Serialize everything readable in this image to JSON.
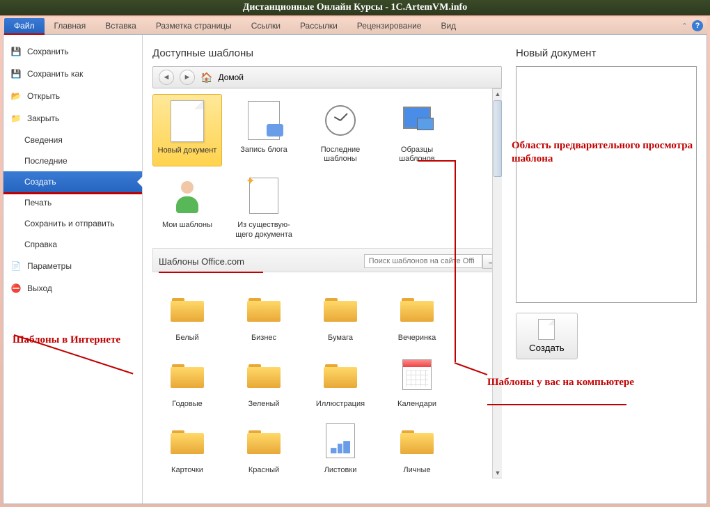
{
  "titlebar": "Дистанционные Онлайн Курсы - 1C.ArtemVM.info",
  "ribbon": {
    "file": "Файл",
    "tabs": [
      "Главная",
      "Вставка",
      "Разметка страницы",
      "Ссылки",
      "Рассылки",
      "Рецензирование",
      "Вид"
    ]
  },
  "nav": {
    "save": "Сохранить",
    "save_as": "Сохранить как",
    "open": "Открыть",
    "close": "Закрыть",
    "info": "Сведения",
    "recent": "Последние",
    "new": "Создать",
    "print": "Печать",
    "save_send": "Сохранить и отправить",
    "help": "Справка",
    "options": "Параметры",
    "exit": "Выход"
  },
  "templates": {
    "title": "Доступные шаблоны",
    "home": "Домой",
    "items_local": [
      {
        "label": "Новый документ",
        "icon": "doc"
      },
      {
        "label": "Запись блога",
        "icon": "blog"
      },
      {
        "label": "Последние шаблоны",
        "icon": "clock"
      },
      {
        "label": "Образцы шаблонов",
        "icon": "monitor"
      },
      {
        "label": "Мои шаблоны",
        "icon": "person"
      },
      {
        "label": "Из существую-щего документа",
        "icon": "sparkle"
      }
    ],
    "office_section": "Шаблоны Office.com",
    "search_placeholder": "Поиск шаблонов на сайте Offi",
    "items_online": [
      {
        "label": "Белый",
        "icon": "folder"
      },
      {
        "label": "Бизнес",
        "icon": "folder"
      },
      {
        "label": "Бумага",
        "icon": "folder"
      },
      {
        "label": "Вечеринка",
        "icon": "folder"
      },
      {
        "label": "Годовые",
        "icon": "folder"
      },
      {
        "label": "Зеленый",
        "icon": "folder"
      },
      {
        "label": "Иллюстрация",
        "icon": "folder"
      },
      {
        "label": "Календари",
        "icon": "calendar"
      },
      {
        "label": "Карточки",
        "icon": "folder"
      },
      {
        "label": "Красный",
        "icon": "folder"
      },
      {
        "label": "Листовки",
        "icon": "chart"
      },
      {
        "label": "Личные",
        "icon": "folder"
      }
    ]
  },
  "preview": {
    "title": "Новый документ",
    "create": "Создать"
  },
  "annotations": {
    "internet": "Шаблоны в Интернете",
    "computer": "Шаблоны у вас на компьютере",
    "preview_area": "Область предварительного просмотра шаблона"
  }
}
